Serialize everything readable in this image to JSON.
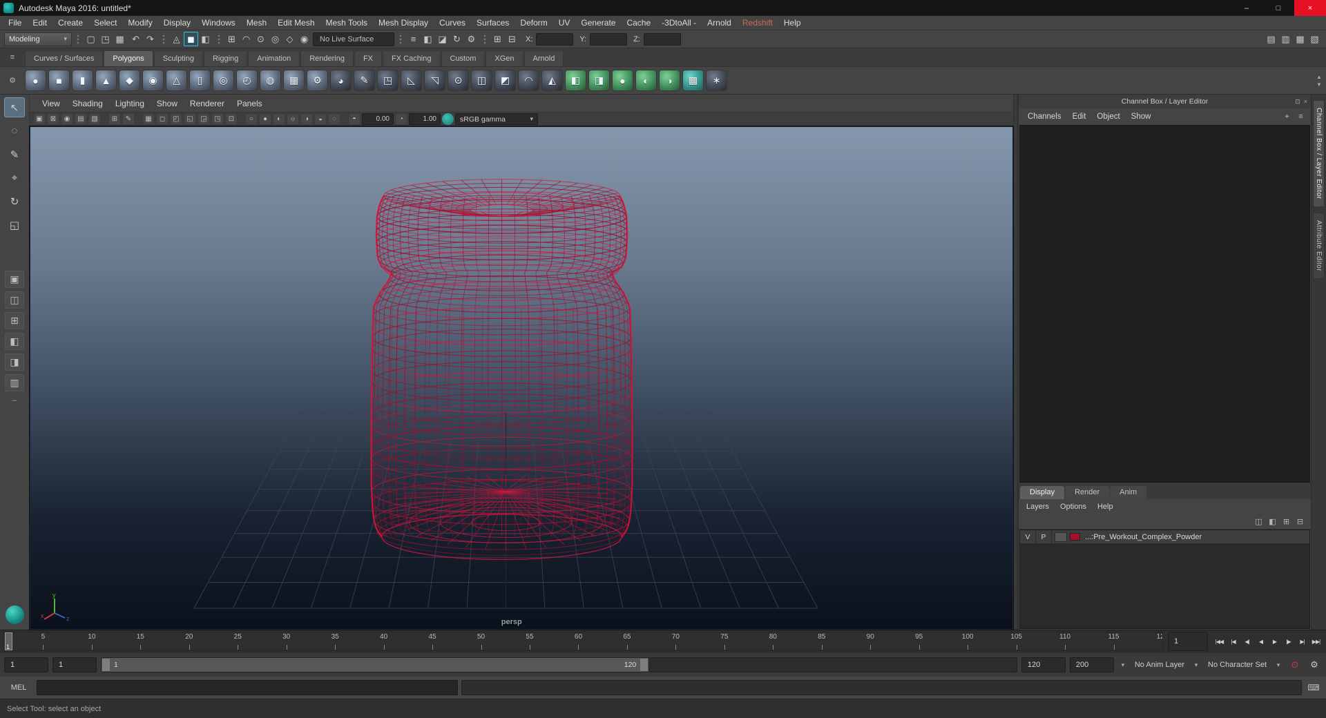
{
  "titlebar": {
    "title": "Autodesk Maya 2016: untitled*",
    "minimize_glyph": "–",
    "maximize_glyph": "□",
    "close_glyph": "×"
  },
  "menubar": {
    "items": [
      {
        "label": "File"
      },
      {
        "label": "Edit"
      },
      {
        "label": "Create"
      },
      {
        "label": "Select"
      },
      {
        "label": "Modify"
      },
      {
        "label": "Display"
      },
      {
        "label": "Windows"
      },
      {
        "label": "Mesh"
      },
      {
        "label": "Edit Mesh"
      },
      {
        "label": "Mesh Tools"
      },
      {
        "label": "Mesh Display"
      },
      {
        "label": "Curves"
      },
      {
        "label": "Surfaces"
      },
      {
        "label": "Deform"
      },
      {
        "label": "UV"
      },
      {
        "label": "Generate"
      },
      {
        "label": "Cache"
      },
      {
        "label": "-3DtoAll -"
      },
      {
        "label": "Arnold"
      },
      {
        "label": "Redshift",
        "color": "#d06a58"
      },
      {
        "label": "Help"
      }
    ]
  },
  "statusline": {
    "sections": [
      {
        "type": "dropdown",
        "name": "menu-set-selector",
        "label": "Modeling"
      },
      {
        "type": "sep"
      },
      {
        "type": "icons",
        "list": [
          {
            "n": "new-scene-icon",
            "g": "▢"
          },
          {
            "n": "open-scene-icon",
            "g": "◳"
          },
          {
            "n": "save-scene-icon",
            "g": "▦"
          }
        ]
      },
      {
        "type": "icons",
        "list": [
          {
            "n": "undo-icon",
            "g": "↶"
          },
          {
            "n": "redo-icon",
            "g": "↷"
          }
        ]
      },
      {
        "type": "sep"
      },
      {
        "type": "icons",
        "list": [
          {
            "n": "select-by-hierarchy-icon",
            "g": "◬"
          },
          {
            "n": "select-by-object-icon",
            "g": "◼",
            "active": true
          },
          {
            "n": "select-by-component-icon",
            "g": "◧"
          }
        ]
      },
      {
        "type": "sep"
      },
      {
        "type": "icons",
        "list": [
          {
            "n": "snap-to-grid-icon",
            "g": "⊞"
          },
          {
            "n": "snap-to-curve-icon",
            "g": "◠"
          },
          {
            "n": "snap-to-point-icon",
            "g": "⊙"
          },
          {
            "n": "snap-to-projected-center-icon",
            "g": "◎"
          },
          {
            "n": "snap-to-view-plane-icon",
            "g": "◇"
          },
          {
            "n": "make-live-icon",
            "g": "◉"
          }
        ]
      },
      {
        "type": "field",
        "name": "live-surface-field",
        "value": "No Live Surface",
        "w": 118
      },
      {
        "type": "sep"
      },
      {
        "type": "icons",
        "list": [
          {
            "n": "construction-history-icon",
            "g": "≡"
          },
          {
            "n": "open-render-view-icon",
            "g": "◧"
          },
          {
            "n": "render-current-frame-icon",
            "g": "◪"
          },
          {
            "n": "ipr-render-icon",
            "g": "↻"
          },
          {
            "n": "render-settings-icon",
            "g": "⚙"
          }
        ]
      },
      {
        "type": "sep"
      },
      {
        "type": "icons",
        "list": [
          {
            "n": "absolute-transform-icon",
            "g": "⊞"
          },
          {
            "n": "relative-transform-icon",
            "g": "⊟"
          }
        ]
      },
      {
        "type": "axes",
        "labels": [
          "X:",
          "Y:",
          "Z:"
        ]
      },
      {
        "type": "spacer"
      },
      {
        "type": "icons",
        "list": [
          {
            "n": "toggle-modeling-toolkit-icon",
            "g": "▤"
          },
          {
            "n": "toggle-attribute-editor-icon",
            "g": "▥"
          },
          {
            "n": "toggle-tool-settings-icon",
            "g": "▦"
          },
          {
            "n": "toggle-channel-box-icon",
            "g": "▧"
          }
        ]
      }
    ]
  },
  "shelf": {
    "tabs_menu_glyph": "≡",
    "shelf_gear_glyph": "⚙",
    "scroll_up_glyph": "▲",
    "scroll_down_glyph": "▼",
    "tabs": [
      {
        "label": "Curves / Surfaces"
      },
      {
        "label": "Polygons",
        "active": true
      },
      {
        "label": "Sculpting"
      },
      {
        "label": "Rigging"
      },
      {
        "label": "Animation"
      },
      {
        "label": "Rendering"
      },
      {
        "label": "FX"
      },
      {
        "label": "FX Caching"
      },
      {
        "label": "Custom"
      },
      {
        "label": "XGen"
      },
      {
        "label": "Arnold"
      }
    ],
    "icons": [
      {
        "n": "polygon-sphere-icon",
        "g": "●",
        "tint": "blue"
      },
      {
        "n": "polygon-cube-icon",
        "g": "■",
        "tint": "blue"
      },
      {
        "n": "polygon-cylinder-icon",
        "g": "▮",
        "tint": "blue"
      },
      {
        "n": "polygon-cone-icon",
        "g": "▲",
        "tint": "blue"
      },
      {
        "n": "polygon-platonic-solid-icon",
        "g": "◆",
        "tint": "blue"
      },
      {
        "n": "polygon-soccer-ball-icon",
        "g": "◉",
        "tint": "blue"
      },
      {
        "n": "polygon-pyramid-icon",
        "g": "△",
        "tint": "blue"
      },
      {
        "n": "polygon-pipe-icon",
        "g": "▯",
        "tint": "blue"
      },
      {
        "n": "polygon-torus-icon",
        "g": "◎",
        "tint": "blue"
      },
      {
        "n": "polygon-helix-icon",
        "g": "◴",
        "tint": "blue"
      },
      {
        "n": "polygon-disc-icon",
        "g": "◍",
        "tint": "blue"
      },
      {
        "n": "polygon-plane-icon",
        "g": "▦",
        "tint": "blue"
      },
      {
        "n": "polygon-gear-icon",
        "g": "⚙",
        "tint": "blue"
      },
      {
        "n": "sculpt-sphere-icon",
        "g": "◕",
        "tint": "dark"
      },
      {
        "n": "pencil-curve-icon",
        "g": "✎",
        "tint": "dark"
      },
      {
        "n": "quad-draw-icon",
        "g": "◳",
        "tint": "dark"
      },
      {
        "n": "multi-cut-icon",
        "g": "◺",
        "tint": "dark"
      },
      {
        "n": "extrude-icon",
        "g": "◹",
        "tint": "dark"
      },
      {
        "n": "target-weld-icon",
        "g": "⊙",
        "tint": "dark"
      },
      {
        "n": "mirror-icon",
        "g": "◫",
        "tint": "dark"
      },
      {
        "n": "bevel-icon",
        "g": "◩",
        "tint": "dark"
      },
      {
        "n": "bridge-icon",
        "g": "◠",
        "tint": "dark"
      },
      {
        "n": "crease-tool-icon",
        "g": "◭",
        "tint": "dark"
      },
      {
        "n": "combine-icon",
        "g": "◧",
        "tint": "green"
      },
      {
        "n": "separate-icon",
        "g": "◨",
        "tint": "green"
      },
      {
        "n": "smooth-icon",
        "g": "●",
        "tint": "green"
      },
      {
        "n": "boolean-icon",
        "g": "◐",
        "tint": "green"
      },
      {
        "n": "sculpt-tool-icon",
        "g": "◑",
        "tint": "green"
      },
      {
        "n": "uv-checker-icon",
        "g": "▩",
        "tint": "teal"
      },
      {
        "n": "poke-face-icon",
        "g": "∗",
        "tint": "dark"
      }
    ]
  },
  "toolbox": {
    "tools": [
      {
        "n": "select-tool-icon",
        "g": "↖",
        "active": true
      },
      {
        "n": "lasso-tool-icon",
        "g": "◌"
      },
      {
        "n": "paint-select-tool-icon",
        "g": "✎"
      },
      {
        "n": "move-tool-icon",
        "g": "⌖"
      },
      {
        "n": "rotate-tool-icon",
        "g": "↻"
      },
      {
        "n": "scale-tool-icon",
        "g": "◱"
      }
    ],
    "layouts": [
      {
        "n": "layout-single-pane-icon",
        "g": "▣"
      },
      {
        "n": "layout-two-pane-icon",
        "g": "◫"
      },
      {
        "n": "layout-four-pane-icon",
        "g": "⊞"
      },
      {
        "n": "layout-persp-outliner-icon",
        "g": "◧"
      },
      {
        "n": "layout-persp-graph-icon",
        "g": "◨"
      },
      {
        "n": "layout-hypershade-icon",
        "g": "▥"
      }
    ],
    "separator_glyph": "–"
  },
  "panel": {
    "menus": [
      "View",
      "Shading",
      "Lighting",
      "Show",
      "Renderer",
      "Panels"
    ],
    "toolbar": [
      {
        "type": "icon",
        "n": "select-camera-icon",
        "g": "▣"
      },
      {
        "type": "icon",
        "n": "lock-camera-icon",
        "g": "⊠"
      },
      {
        "type": "icon",
        "n": "camera-attributes-icon",
        "g": "◉"
      },
      {
        "type": "icon",
        "n": "bookmarks-icon",
        "g": "▤"
      },
      {
        "type": "icon",
        "n": "image-plane-icon",
        "g": "▧"
      },
      {
        "type": "sep"
      },
      {
        "type": "icon",
        "n": "2d-pan-zoom-icon",
        "g": "⊞"
      },
      {
        "type": "icon",
        "n": "grease-pencil-icon",
        "g": "✎"
      },
      {
        "type": "sep"
      },
      {
        "type": "icon",
        "n": "grid-toggle-icon",
        "g": "▦"
      },
      {
        "type": "icon",
        "n": "film-gate-icon",
        "g": "◻"
      },
      {
        "type": "icon",
        "n": "resolution-gate-icon",
        "g": "◰"
      },
      {
        "type": "icon",
        "n": "gate-mask-icon",
        "g": "◱"
      },
      {
        "type": "icon",
        "n": "field-chart-icon",
        "g": "◲"
      },
      {
        "type": "icon",
        "n": "safe-action-icon",
        "g": "◳"
      },
      {
        "type": "icon",
        "n": "safe-title-icon",
        "g": "⊡"
      },
      {
        "type": "sep"
      },
      {
        "type": "icon",
        "n": "wireframe-display-icon",
        "g": "○"
      },
      {
        "type": "icon",
        "n": "smooth-shade-icon",
        "g": "●"
      },
      {
        "type": "icon",
        "n": "textured-display-icon",
        "g": "◐"
      },
      {
        "type": "icon",
        "n": "use-all-lights-icon",
        "g": "☼"
      },
      {
        "type": "icon",
        "n": "shadows-icon",
        "g": "◑"
      },
      {
        "type": "icon",
        "n": "occlusion-icon",
        "g": "◒"
      },
      {
        "type": "icon",
        "n": "motion-blur-icon",
        "g": "◌"
      },
      {
        "type": "sep"
      },
      {
        "type": "icon",
        "n": "exposure-icon",
        "g": "◓"
      },
      {
        "type": "field",
        "n": "exposure-field",
        "value": "0.00"
      },
      {
        "type": "icon",
        "n": "gamma-icon",
        "g": "◔"
      },
      {
        "type": "field",
        "n": "gamma-field",
        "value": "1.00"
      },
      {
        "type": "badge",
        "n": "color-management-icon"
      },
      {
        "type": "dropdown",
        "n": "view-transform-selector",
        "value": "sRGB gamma"
      }
    ]
  },
  "viewport": {
    "camera_label": "persp",
    "bg_stops": [
      "#8597ac",
      "#68798e",
      "#3d4b5e",
      "#182231",
      "#0b111c"
    ],
    "colors": {
      "wire": "#d5163c",
      "wire_dark": "#9c0f2e",
      "grid": "#3b4352",
      "grid_axis": "#222836"
    },
    "axis_colors": {
      "x": "#bf4040",
      "y": "#4fba32",
      "z": "#3a5fc8"
    },
    "axis_labels": {
      "x": "x",
      "y": "y",
      "z": "z"
    }
  },
  "channelbox": {
    "title": "Channel Box / Layer Editor",
    "float_glyph": "⊡",
    "close_glyph": "×",
    "menus": [
      "Channels",
      "Edit",
      "Object",
      "Show"
    ],
    "menu_icons": [
      {
        "n": "channel-manipulator-icon",
        "g": "⌖"
      },
      {
        "n": "channel-speed-control-icon",
        "g": "≡"
      }
    ],
    "layer_tabs": [
      {
        "label": "Display",
        "active": true
      },
      {
        "label": "Render"
      },
      {
        "label": "Anim"
      }
    ],
    "layer_menus": [
      "Layers",
      "Options",
      "Help"
    ],
    "layer_toolbar_icons": [
      {
        "n": "toggle-all-layers-icon",
        "g": "◫"
      },
      {
        "n": "sort-layers-icon",
        "g": "◧"
      },
      {
        "n": "create-empty-layer-icon",
        "g": "⊞"
      },
      {
        "n": "create-layer-from-selected-icon",
        "g": "⊟"
      }
    ],
    "layer": {
      "v": "V",
      "p": "P",
      "name": "...:Pre_Workout_Complex_Powder",
      "color": "#a6102f"
    }
  },
  "right_tabs": [
    {
      "label": "Channel Box / Layer Editor",
      "active": true
    },
    {
      "label": "Attribute Editor"
    }
  ],
  "timeline": {
    "start": 1,
    "end": 120,
    "label_step": 5,
    "current": 1,
    "current_field": "1",
    "playback": [
      {
        "n": "go-to-playback-start-button",
        "g": "|◀◀"
      },
      {
        "n": "step-back-one-key-button",
        "g": "|◀"
      },
      {
        "n": "step-back-one-frame-button",
        "g": "◀|"
      },
      {
        "n": "play-backwards-button",
        "g": "◀"
      },
      {
        "n": "play-forwards-button",
        "g": "▶"
      },
      {
        "n": "step-forward-one-frame-button",
        "g": "|▶"
      },
      {
        "n": "step-forward-one-key-button",
        "g": "▶|"
      },
      {
        "n": "go-to-playback-end-button",
        "g": "▶▶|"
      }
    ]
  },
  "range": {
    "anim_start": 1,
    "play_start": 1,
    "play_end": 120,
    "anim_end": 200,
    "anim_layer": "No Anim Layer",
    "char_set": "No Character Set",
    "autokey_glyph": "⊙",
    "autokey_color": "#cf3d3d",
    "prefs_glyph": "⚙"
  },
  "command_line": {
    "label": "MEL",
    "script_icon_glyph": "⌨"
  },
  "help_line": {
    "text": "Select Tool: select an object"
  }
}
